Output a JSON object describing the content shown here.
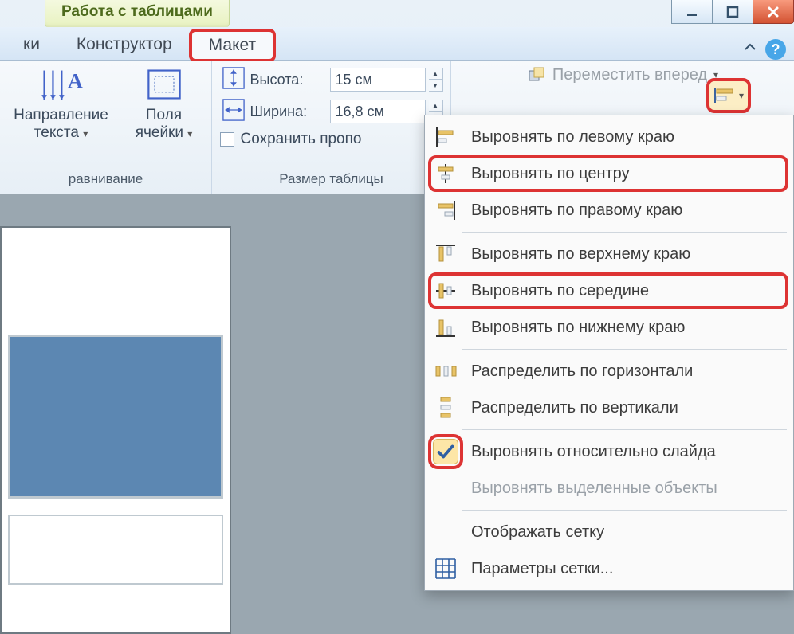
{
  "titlebar": {
    "context_tab": "Работа с таблицами"
  },
  "tabs": {
    "t0": "ки",
    "t1": "Конструктор",
    "t2": "Макет"
  },
  "ribbon": {
    "alignment": {
      "text_direction_l1": "Направление",
      "text_direction_l2": "текста",
      "margins_l1": "Поля",
      "margins_l2": "ячейки",
      "group_label": "равнивание"
    },
    "size": {
      "height_label": "Высота:",
      "height_value": "15 см",
      "width_label": "Ширина:",
      "width_value": "16,8 см",
      "lockaspect": "Сохранить пропо",
      "group_label": "Размер таблицы"
    },
    "arrange": {
      "bring_forward": "Переместить вперед"
    }
  },
  "menu": {
    "m1": "Выровнять по левому краю",
    "m2": "Выровнять по центру",
    "m3": "Выровнять по правому краю",
    "m4": "Выровнять по верхнему краю",
    "m5": "Выровнять по середине",
    "m6": "Выровнять по нижнему краю",
    "m7": "Распределить по горизонтали",
    "m8": "Распределить по вертикали",
    "m9": "Выровнять относительно слайда",
    "m10": "Выровнять выделенные объекты",
    "m11": "Отображать сетку",
    "m12": "Параметры сетки..."
  }
}
